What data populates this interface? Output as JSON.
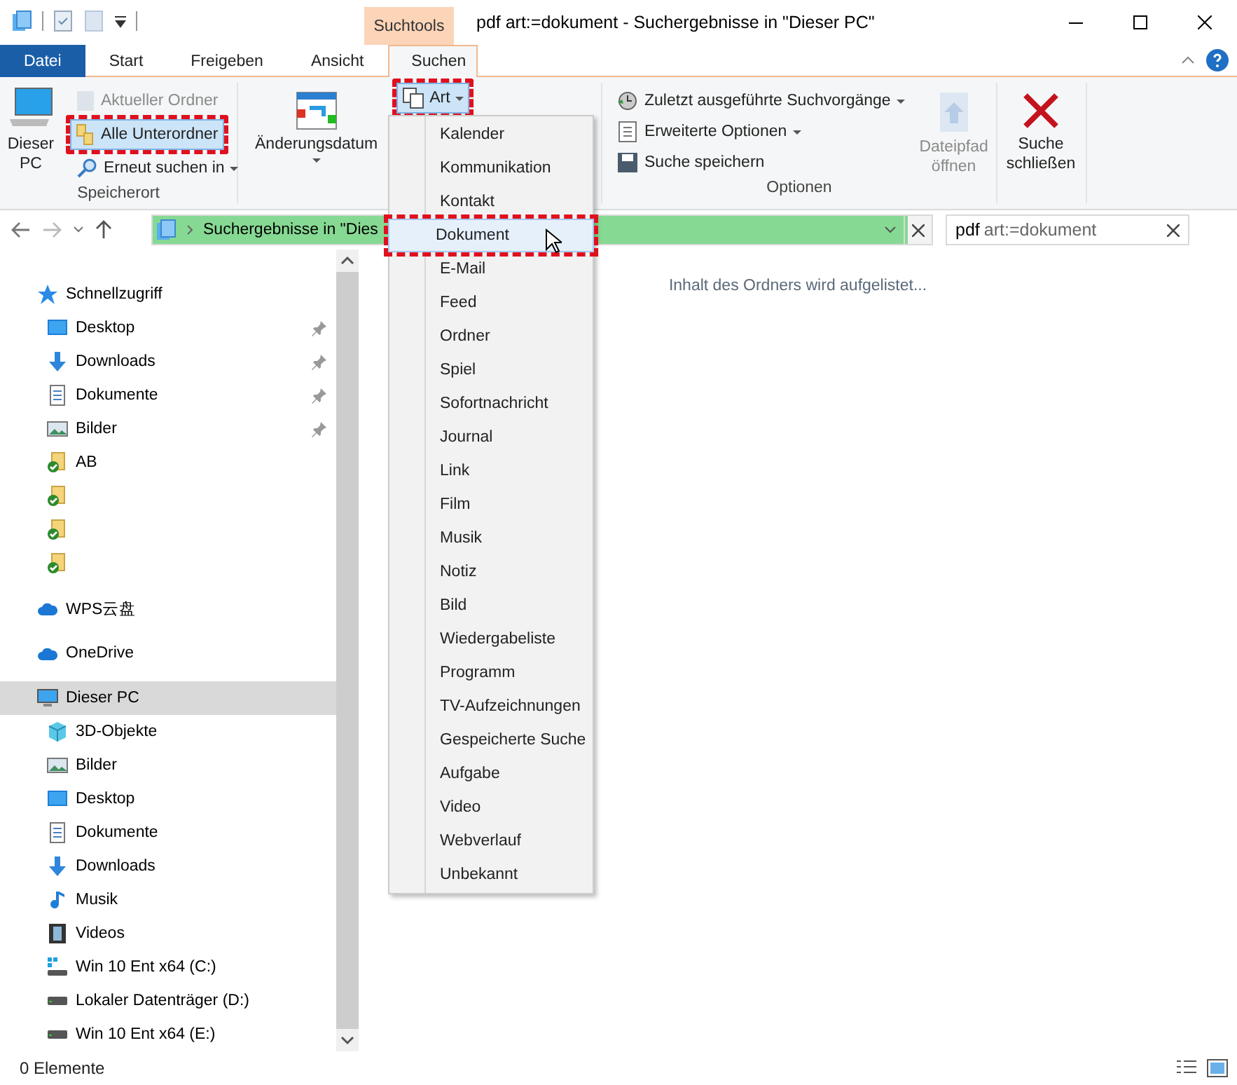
{
  "window": {
    "title": "pdf art:=dokument - Suchergebnisse in \"Dieser PC\"",
    "context_tab": "Suchtools"
  },
  "tabs": [
    {
      "label": "Datei",
      "kind": "file",
      "selected": false
    },
    {
      "label": "Start",
      "kind": "normal",
      "selected": false
    },
    {
      "label": "Freigeben",
      "kind": "normal",
      "selected": false
    },
    {
      "label": "Ansicht",
      "kind": "normal",
      "selected": false
    },
    {
      "label": "Suchen",
      "kind": "normal",
      "selected": true
    }
  ],
  "ribbon": {
    "location_group": {
      "label": "Speicherort",
      "large_button": "Dieser PC",
      "buttons": [
        {
          "label": "Aktueller Ordner",
          "disabled": true,
          "highlighted": false,
          "dropdown": false
        },
        {
          "label": "Alle Unterordner",
          "disabled": false,
          "highlighted": true,
          "dropdown": false
        },
        {
          "label": "Erneut suchen in",
          "disabled": false,
          "highlighted": false,
          "dropdown": true
        }
      ]
    },
    "refine_group": {
      "date_button": "Änderungsdatum",
      "kind_button": {
        "label": "Art",
        "highlighted": true
      }
    },
    "options_group": {
      "label": "Optionen",
      "buttons": [
        {
          "label": "Zuletzt ausgeführte Suchvorgänge",
          "dropdown": true
        },
        {
          "label": "Erweiterte Optionen",
          "dropdown": true
        },
        {
          "label": "Suche speichern",
          "dropdown": false
        }
      ],
      "open_path": {
        "label": "Dateipfad öffnen",
        "disabled": true
      }
    },
    "close_button": "Suche schließen"
  },
  "address_bar": {
    "path": "Suchergebnisse in \"Dies",
    "level": 0.97
  },
  "search": {
    "query": "pdf",
    "filter": "art:=dokument"
  },
  "kind_menu": [
    {
      "label": "Kalender",
      "selected": false,
      "highlighted": false
    },
    {
      "label": "Kommunikation",
      "selected": false,
      "highlighted": false
    },
    {
      "label": "Kontakt",
      "selected": false,
      "highlighted": false
    },
    {
      "label": "Dokument",
      "selected": true,
      "highlighted": true
    },
    {
      "label": "E-Mail",
      "selected": false,
      "highlighted": false
    },
    {
      "label": "Feed",
      "selected": false,
      "highlighted": false
    },
    {
      "label": "Ordner",
      "selected": false,
      "highlighted": false
    },
    {
      "label": "Spiel",
      "selected": false,
      "highlighted": false
    },
    {
      "label": "Sofortnachricht",
      "selected": false,
      "highlighted": false
    },
    {
      "label": "Journal",
      "selected": false,
      "highlighted": false
    },
    {
      "label": "Link",
      "selected": false,
      "highlighted": false
    },
    {
      "label": "Film",
      "selected": false,
      "highlighted": false
    },
    {
      "label": "Musik",
      "selected": false,
      "highlighted": false
    },
    {
      "label": "Notiz",
      "selected": false,
      "highlighted": false
    },
    {
      "label": "Bild",
      "selected": false,
      "highlighted": false
    },
    {
      "label": "Wiedergabeliste",
      "selected": false,
      "highlighted": false
    },
    {
      "label": "Programm",
      "selected": false,
      "highlighted": false
    },
    {
      "label": "TV-Aufzeichnungen",
      "selected": false,
      "highlighted": false
    },
    {
      "label": "Gespeicherte Suche",
      "selected": false,
      "highlighted": false
    },
    {
      "label": "Aufgabe",
      "selected": false,
      "highlighted": false
    },
    {
      "label": "Video",
      "selected": false,
      "highlighted": false
    },
    {
      "label": "Webverlauf",
      "selected": false,
      "highlighted": false
    },
    {
      "label": "Unbekannt",
      "selected": false,
      "highlighted": false
    }
  ],
  "sidebar": {
    "sections": [
      {
        "label": "Schnellzugriff",
        "kind": "star",
        "selected": false,
        "children": [
          {
            "label": "Desktop",
            "kind": "desktop",
            "pinned": true,
            "selected": false
          },
          {
            "label": "Downloads",
            "kind": "download",
            "pinned": true,
            "selected": false
          },
          {
            "label": "Dokumente",
            "kind": "document",
            "pinned": true,
            "selected": false
          },
          {
            "label": "Bilder",
            "kind": "image",
            "pinned": true,
            "selected": false
          },
          {
            "label": "AB",
            "kind": "folder-check",
            "pinned": false,
            "selected": false
          },
          {
            "kind": "folder-check",
            "pinned": false,
            "selected": false
          },
          {
            "kind": "folder-check",
            "pinned": false,
            "selected": false
          },
          {
            "kind": "folder-check",
            "pinned": false,
            "selected": false
          }
        ]
      },
      {
        "label": "WPS云盘",
        "kind": "cloud",
        "selected": false
      },
      {
        "label": "OneDrive",
        "kind": "cloud",
        "selected": false
      },
      {
        "label": "Dieser PC",
        "kind": "pc",
        "selected": true,
        "children": [
          {
            "label": "3D-Objekte",
            "kind": "cube",
            "pinned": false,
            "selected": false
          },
          {
            "label": "Bilder",
            "kind": "image",
            "pinned": false,
            "selected": false
          },
          {
            "label": "Desktop",
            "kind": "desktop",
            "pinned": false,
            "selected": false
          },
          {
            "label": "Dokumente",
            "kind": "document",
            "pinned": false,
            "selected": false
          },
          {
            "label": "Downloads",
            "kind": "download",
            "pinned": false,
            "selected": false
          },
          {
            "label": "Musik",
            "kind": "music",
            "pinned": false,
            "selected": false
          },
          {
            "label": "Videos",
            "kind": "video",
            "pinned": false,
            "selected": false
          },
          {
            "label": "Win 10 Ent x64 (C:)",
            "kind": "drive-win",
            "pinned": false,
            "selected": false
          },
          {
            "label": "Lokaler Datenträger (D:)",
            "kind": "drive",
            "pinned": false,
            "selected": false
          },
          {
            "label": "Win 10 Ent x64 (E:)",
            "kind": "drive",
            "pinned": false,
            "selected": false
          }
        ]
      }
    ]
  },
  "content": {
    "message": "Inhalt des Ordners wird aufgelistet..."
  },
  "status_bar": {
    "count": "0 Elemente"
  }
}
